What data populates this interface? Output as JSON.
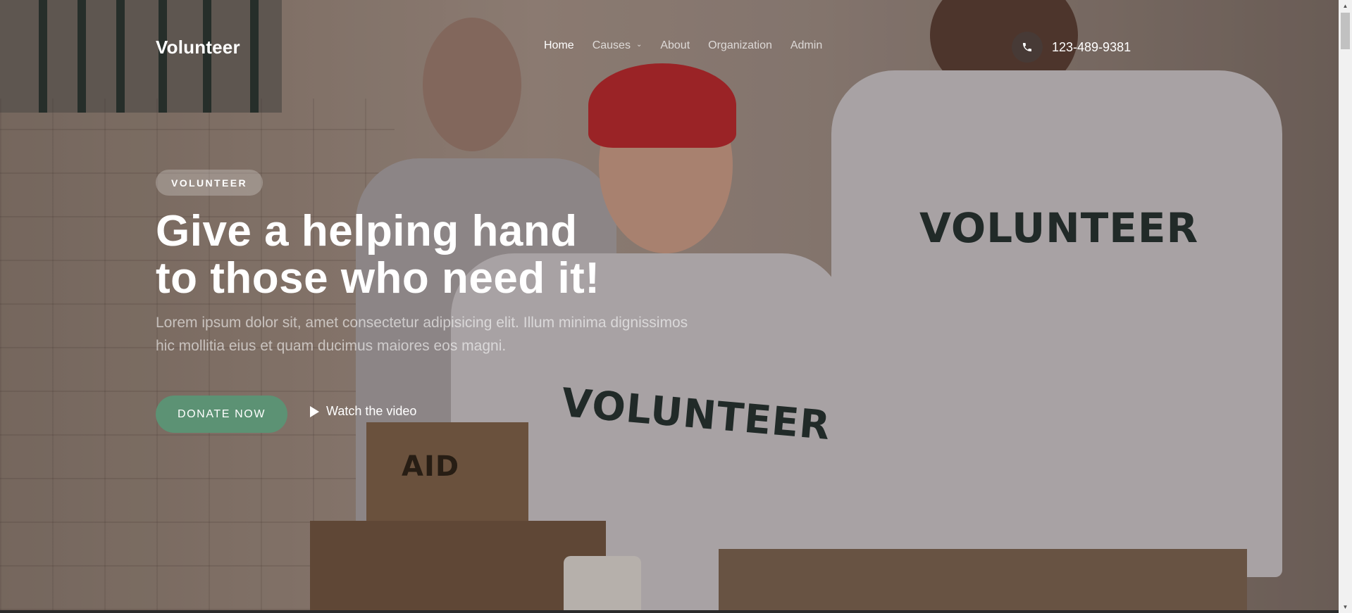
{
  "header": {
    "logo": "Volunteer",
    "nav": [
      {
        "label": "Home",
        "active": true,
        "dropdown": false
      },
      {
        "label": "Causes",
        "active": false,
        "dropdown": true
      },
      {
        "label": "About",
        "active": false,
        "dropdown": false
      },
      {
        "label": "Organization",
        "active": false,
        "dropdown": false
      },
      {
        "label": "Admin",
        "active": false,
        "dropdown": false
      }
    ],
    "phone": {
      "icon": "phone-icon",
      "number": "123-489-9381"
    }
  },
  "hero": {
    "badge": "VOLUNTEER",
    "headline_line1": "Give a helping hand",
    "headline_line2": "to those who need it!",
    "subtext": "Lorem ipsum dolor sit, amet consectetur adipisicing elit. Illum minima dignissimos hic mollitia eius et quam ducimus maiores eos magni.",
    "donate_label": "DONATE NOW",
    "watch_label": "Watch the video",
    "background_scene": {
      "shirt_text": "VOLUNTEER",
      "box_label": "AID"
    }
  },
  "colors": {
    "accent_green": "#5c9274",
    "text_white": "#ffffff"
  }
}
